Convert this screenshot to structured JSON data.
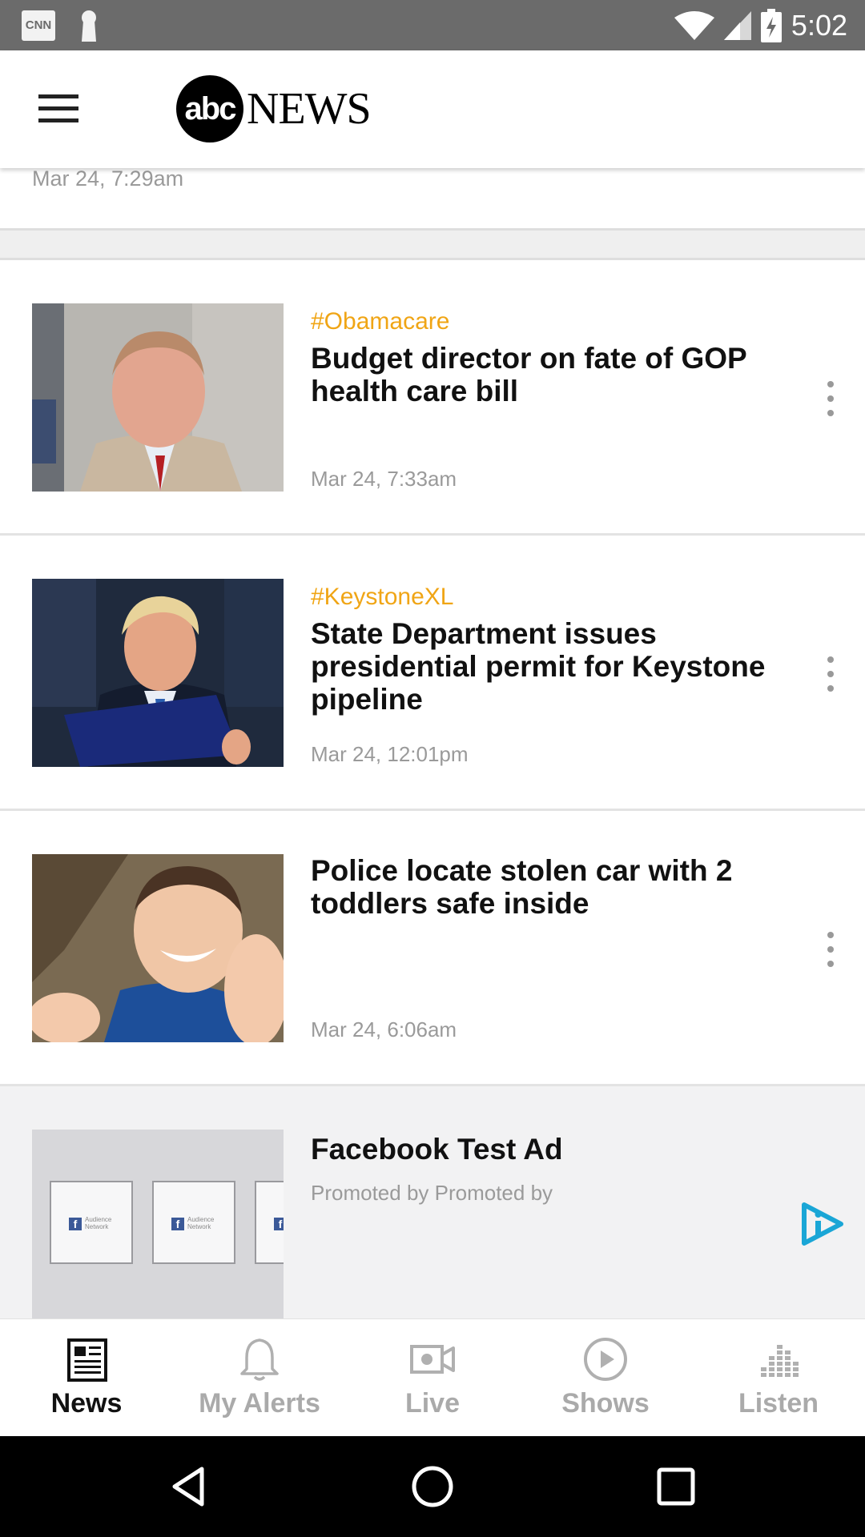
{
  "status_bar": {
    "notification_icons": [
      "cnn-icon",
      "keyhole-icon"
    ],
    "cnn_label": "CNN",
    "time": "5:02"
  },
  "app_bar": {
    "logo_circle": "abc",
    "logo_text": "NEWS"
  },
  "feed": {
    "partial_item_date": "Mar 24, 7:29am",
    "articles": [
      {
        "tag": "#Obamacare",
        "headline": "Budget director on fate of GOP health care bill",
        "date": "Mar 24, 7:33am"
      },
      {
        "tag": "#KeystoneXL",
        "headline": "State Department issues presidential permit for Keystone pipeline",
        "date": "Mar 24, 12:01pm"
      },
      {
        "tag": "",
        "headline": "Police locate stolen car with 2 toddlers safe inside",
        "date": "Mar 24, 6:06am"
      }
    ],
    "ad": {
      "title": "Facebook Test Ad",
      "promoted": "Promoted by Promoted by",
      "card_text": "Audience Network"
    }
  },
  "bottom_nav": {
    "items": [
      {
        "label": "News",
        "icon": "newspaper-icon",
        "active": true
      },
      {
        "label": "My Alerts",
        "icon": "bell-icon",
        "active": false
      },
      {
        "label": "Live",
        "icon": "video-camera-icon",
        "active": false
      },
      {
        "label": "Shows",
        "icon": "play-circle-icon",
        "active": false
      },
      {
        "label": "Listen",
        "icon": "equalizer-icon",
        "active": false
      }
    ]
  },
  "colors": {
    "tag": "#f0a515",
    "status_bar": "#6b6b6b",
    "ad_choices": "#1aa6d6",
    "nav_active": "#111111",
    "nav_inactive": "#aaaaaa"
  }
}
